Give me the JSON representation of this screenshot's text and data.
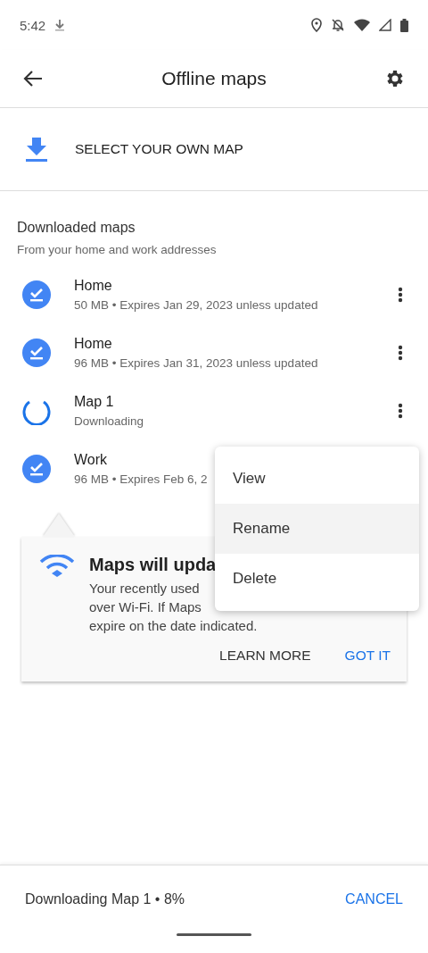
{
  "status_bar": {
    "time": "5:42"
  },
  "toolbar": {
    "title": "Offline maps"
  },
  "select_map": {
    "label": "SELECT YOUR OWN MAP"
  },
  "section": {
    "title": "Downloaded maps",
    "subtitle": "From your home and work addresses"
  },
  "maps": [
    {
      "kind": "downloaded",
      "name": "Home",
      "detail": "50 MB • Expires Jan 29, 2023 unless updated",
      "menu": true
    },
    {
      "kind": "downloaded",
      "name": "Home",
      "detail": "96 MB • Expires Jan 31, 2023 unless updated",
      "menu": true
    },
    {
      "kind": "downloading",
      "name": "Map 1",
      "detail": "Downloading",
      "menu": true
    },
    {
      "kind": "downloaded",
      "name": "Work",
      "detail": "96 MB • Expires Feb 6, 2"
    }
  ],
  "tip": {
    "title": "Maps will upda",
    "lines": [
      "Your recently used",
      "over Wi-Fi. If Maps",
      "expire on the date indicated."
    ],
    "actions": [
      {
        "label": "LEARN MORE",
        "primary": false
      },
      {
        "label": "GOT IT",
        "primary": true
      }
    ]
  },
  "menu": [
    {
      "label": "View",
      "selected": false
    },
    {
      "label": "Rename",
      "selected": true
    },
    {
      "label": "Delete",
      "selected": false
    }
  ],
  "footer": {
    "status": "Downloading Map 1 • 8%",
    "action": "CANCEL"
  }
}
